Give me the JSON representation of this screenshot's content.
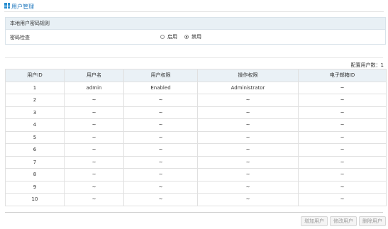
{
  "header": {
    "title": "用户管理"
  },
  "policy": {
    "section_title": "本地用户密码规则",
    "password_check_label": "密码检查",
    "options": [
      {
        "label": "启用",
        "checked": false
      },
      {
        "label": "禁用",
        "checked": true
      }
    ]
  },
  "user_count_label": "配置用户数：1",
  "table": {
    "columns": [
      "用户ID",
      "用户名",
      "用户权限",
      "操作权限",
      "电子邮箱ID"
    ],
    "rows": [
      [
        "1",
        "admin",
        "Enabled",
        "Administrator",
        "~"
      ],
      [
        "2",
        "~",
        "~",
        "~",
        "~"
      ],
      [
        "3",
        "~",
        "~",
        "~",
        "~"
      ],
      [
        "4",
        "~",
        "~",
        "~",
        "~"
      ],
      [
        "5",
        "~",
        "~",
        "~",
        "~"
      ],
      [
        "6",
        "~",
        "~",
        "~",
        "~"
      ],
      [
        "7",
        "~",
        "~",
        "~",
        "~"
      ],
      [
        "8",
        "~",
        "~",
        "~",
        "~"
      ],
      [
        "9",
        "~",
        "~",
        "~",
        "~"
      ],
      [
        "10",
        "~",
        "~",
        "~",
        "~"
      ]
    ]
  },
  "buttons": {
    "add": "增加用户",
    "edit": "修改用户",
    "delete": "删除用户"
  },
  "colors": {
    "accent": "#2a8fd0",
    "header_bg": "#eaf1f6"
  }
}
